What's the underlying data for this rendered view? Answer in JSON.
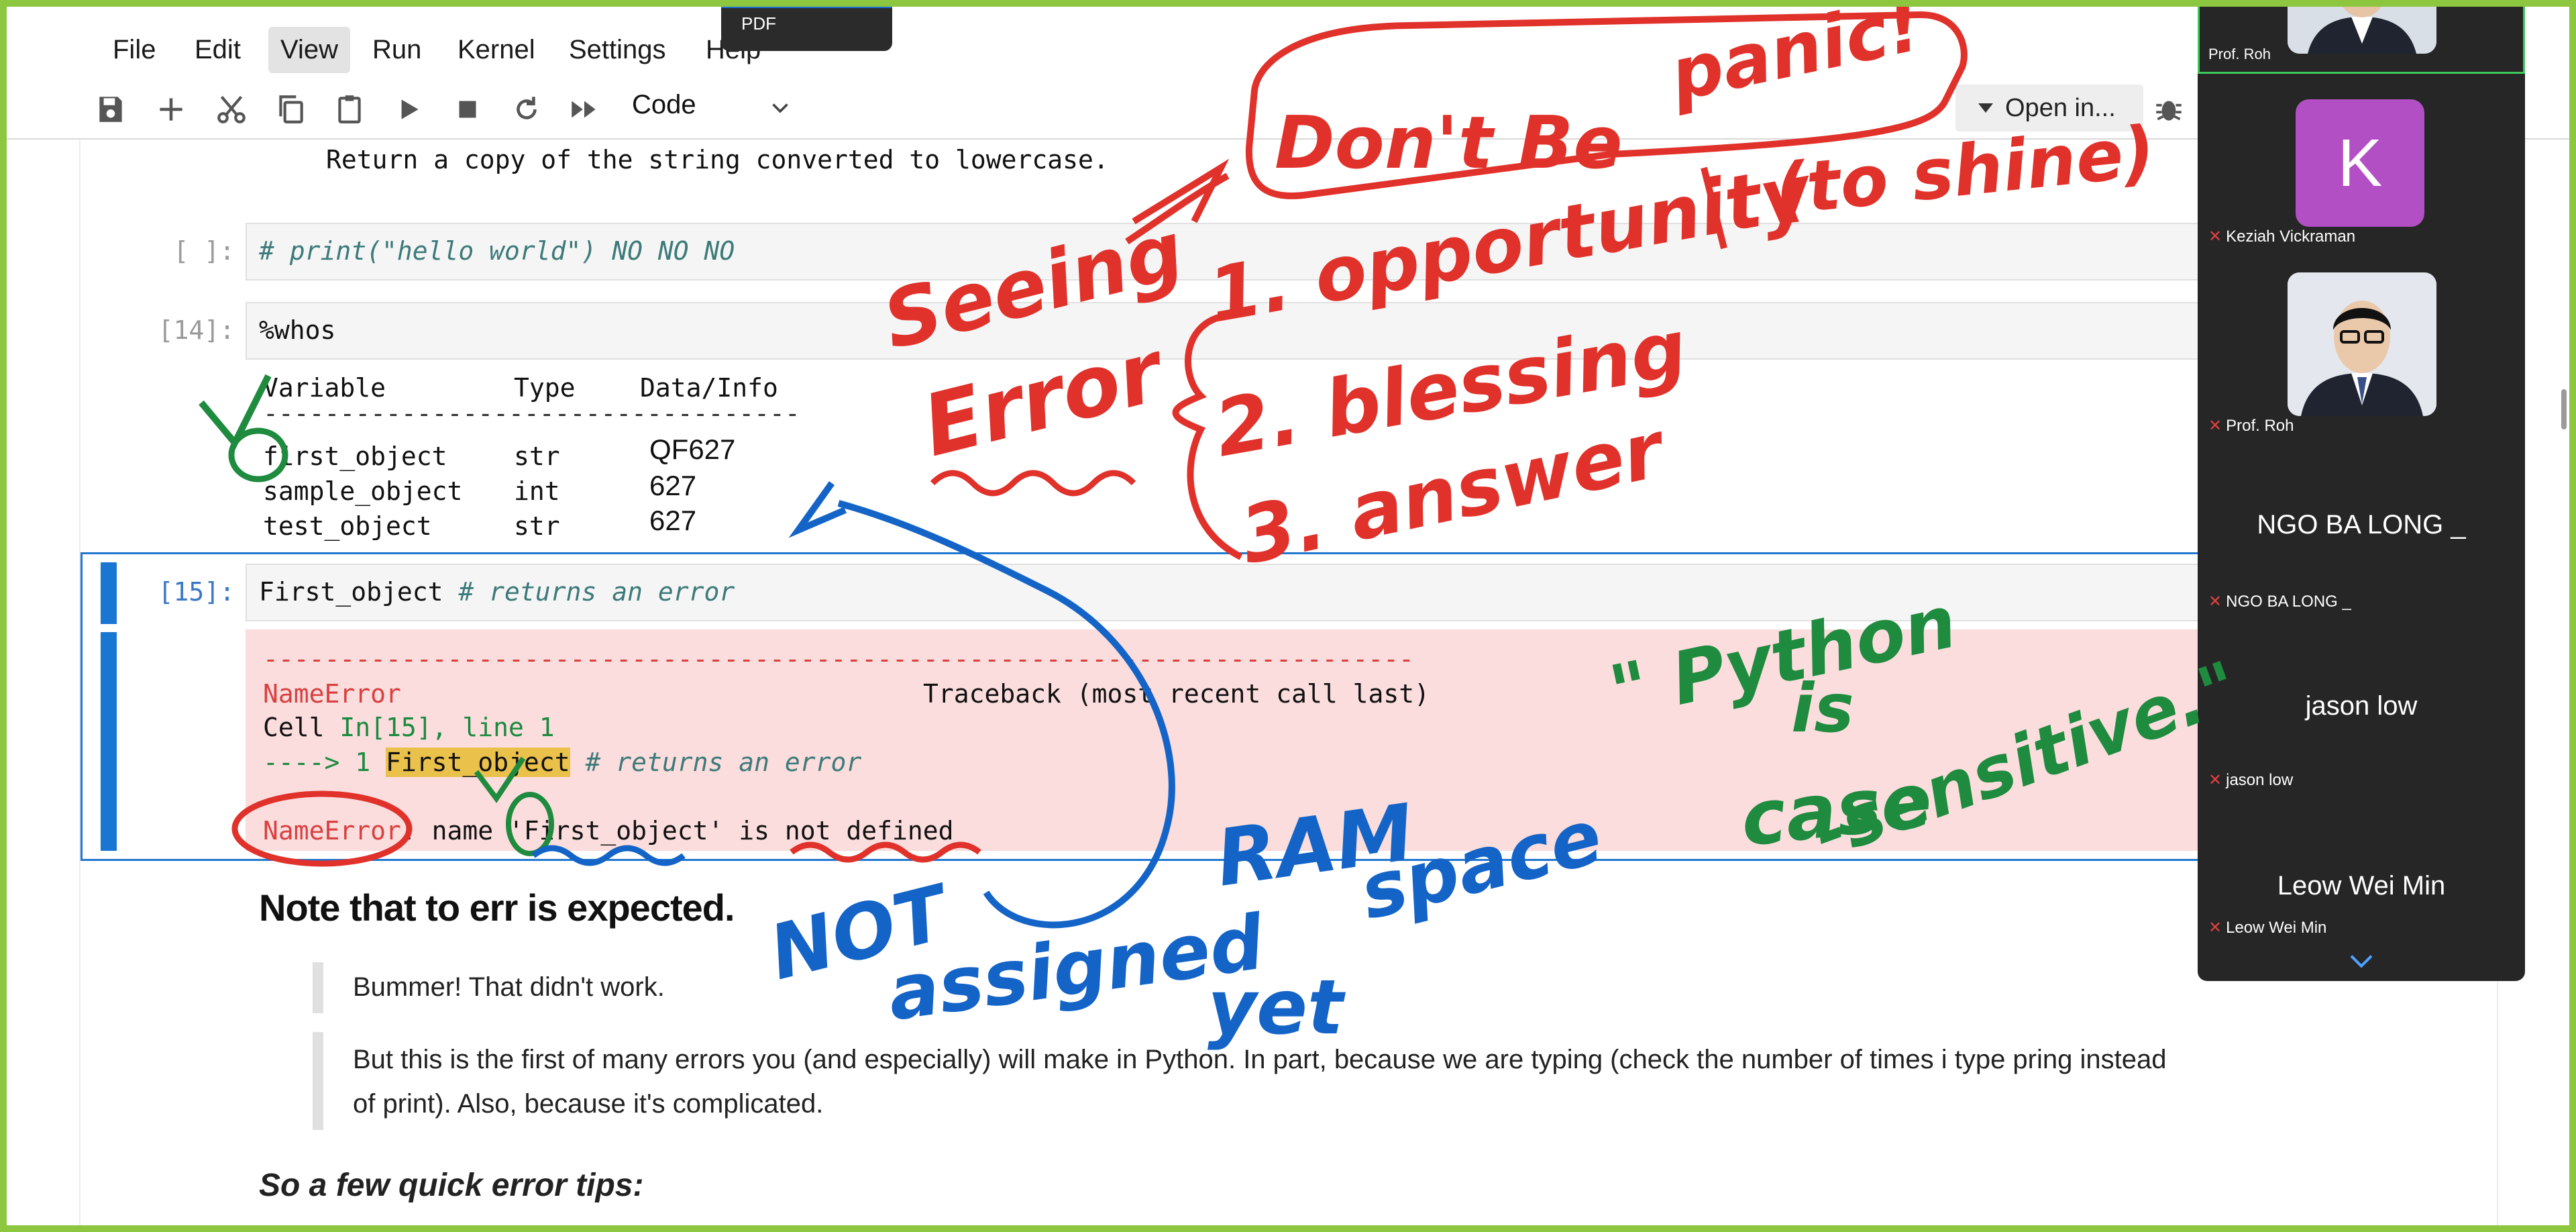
{
  "menu": {
    "items": [
      {
        "label": "File"
      },
      {
        "label": "Edit"
      },
      {
        "label": "View"
      },
      {
        "label": "Run"
      },
      {
        "label": "Kernel"
      },
      {
        "label": "Settings"
      },
      {
        "label": "Help"
      }
    ],
    "active_item": "View"
  },
  "popover": {
    "label": "PDF"
  },
  "toolbar": {
    "cell_type": "Code",
    "open_in": "Open in...",
    "icons": [
      "save-icon",
      "add-cell-icon",
      "cut-icon",
      "copy-icon",
      "paste-icon",
      "run-icon",
      "stop-icon",
      "restart-icon",
      "run-all-icon",
      "chevron-down-icon",
      "bug-icon"
    ]
  },
  "notebook": {
    "doc_line": "Return a copy of the string converted to lowercase.",
    "cells": {
      "c1": {
        "prompt": "[ ]:",
        "code_comment": "# print(\"hello world\") NO NO NO"
      },
      "c2": {
        "prompt": "[14]:",
        "code": "%whos",
        "whos_header": {
          "variable": "Variable",
          "type": "Type",
          "info": "Data/Info"
        },
        "whos_rule": "-----------------------------------",
        "whos_rows": [
          {
            "variable": "first_object",
            "type": "str",
            "info": "QF627"
          },
          {
            "variable": "sample_object",
            "type": "int",
            "info": "627"
          },
          {
            "variable": "test_object",
            "type": "str",
            "info": "627"
          }
        ]
      },
      "c3": {
        "prompt": "[15]:",
        "code": "First_object ",
        "code_comment": "# returns an error",
        "traceback": {
          "dashes": "---------------------------------------------------------------------------",
          "error_name": "NameError",
          "header_right": "Traceback (most recent call last)",
          "cell_prefix": "Cell ",
          "cell_ref": "In[15], line 1",
          "arrow": "----> 1 ",
          "arrow_highlight": "First_object",
          "arrow_comment": " # returns an error",
          "final_name": "NameError",
          "final_message": ": name 'First_object' is not defined"
        }
      }
    },
    "markdown": {
      "heading": "Note that to err is expected.",
      "quote1": "Bummer! That didn't work.",
      "quote2_line1": "But this is the first of many errors you (and especially) will make in Python. In part, because we are typing (check the number of times i type pring instead",
      "quote2_line2": "of print). Also, because it's complicated.",
      "tips_heading": "So a few quick error tips:"
    }
  },
  "zoom": {
    "participants": [
      {
        "label": "Prof. Roh"
      },
      {
        "avatar_letter": "K",
        "label": "Keziah Vickraman"
      },
      {
        "label": "Prof. Roh"
      },
      {
        "display": "NGO BA LONG _",
        "label": "NGO BA LONG _"
      },
      {
        "display": "jason low",
        "label": "jason low"
      },
      {
        "display": "Leow Wei Min",
        "label": "Leow Wei Min"
      }
    ]
  },
  "annotations": {
    "red": {
      "dont_be": "Don't Be",
      "panic": "panic!",
      "seeing": "Seeing",
      "error": "Error",
      "opportunity": "1. opportunity",
      "to_shine": "(to shine)",
      "blessing": "2. blessing",
      "answer": "3. answer"
    },
    "blue": {
      "not": "NOT",
      "assigned": "assigned",
      "yet": "yet",
      "ram": "RAM",
      "space": "space"
    },
    "green": {
      "python": "\" Python",
      "is": "is",
      "case": "case",
      "sensitive": "-sensitive.\""
    }
  },
  "colors": {
    "frame": "#8dc63f",
    "accent": "#1976d2",
    "error_bg": "#fbdddd",
    "ink_red": "#e0322b",
    "ink_blue": "#1464c8",
    "ink_green": "#1e8b3e"
  }
}
